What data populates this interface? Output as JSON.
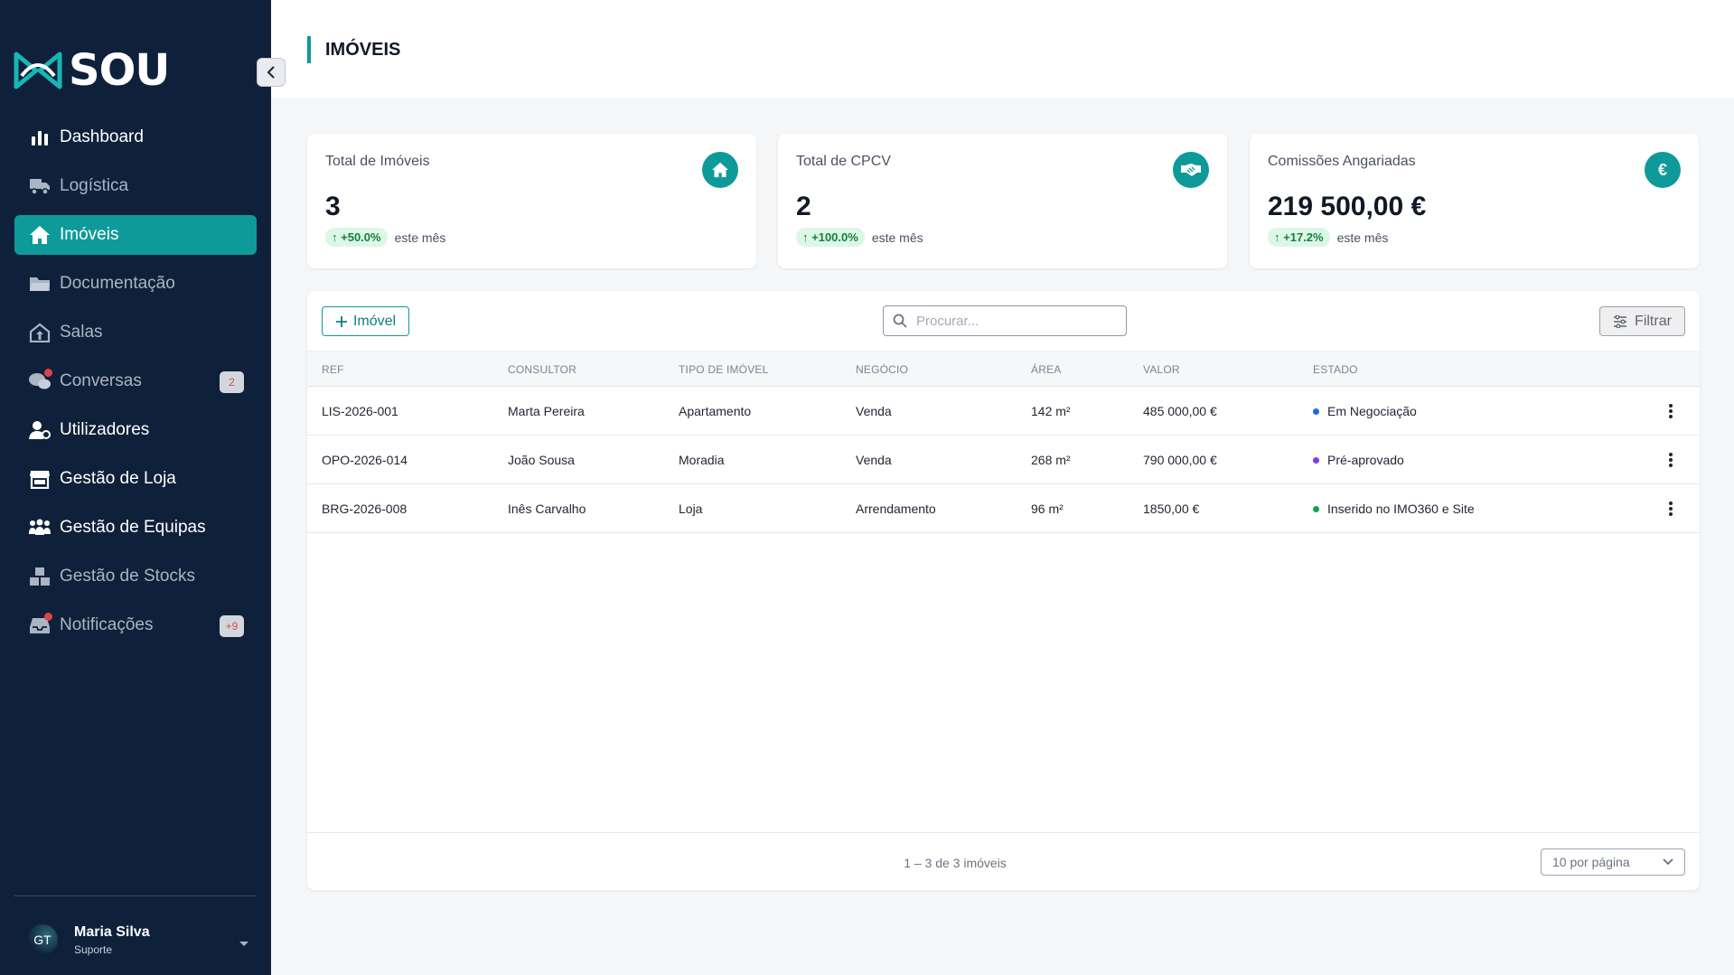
{
  "app": {
    "logo_text": "SOU"
  },
  "sidebar": {
    "items": [
      {
        "label": "Dashboard",
        "icon": "bar-chart-icon"
      },
      {
        "label": "Logística",
        "icon": "truck-icon"
      },
      {
        "label": "Imóveis",
        "icon": "home-icon",
        "active": true
      },
      {
        "label": "Documentação",
        "icon": "folder-icon"
      },
      {
        "label": "Salas",
        "icon": "room-icon"
      },
      {
        "label": "Conversas",
        "icon": "chat-icon",
        "badge": "2"
      },
      {
        "label": "Utilizadores",
        "icon": "user-gear-icon"
      },
      {
        "label": "Gestão de Loja",
        "icon": "store-icon"
      },
      {
        "label": "Gestão de Equipas",
        "icon": "team-icon"
      },
      {
        "label": "Gestão de Stocks",
        "icon": "boxes-icon"
      },
      {
        "label": "Notificações",
        "icon": "inbox-icon",
        "badge": "+9"
      }
    ],
    "user": {
      "initials": "GT",
      "name": "Maria Silva",
      "role": "Suporte"
    }
  },
  "header": {
    "title": "IMÓVEIS"
  },
  "stats": [
    {
      "label": "Total de Imóveis",
      "value": "3",
      "delta": "+50.0%",
      "note": "este mês",
      "icon": "home-icon"
    },
    {
      "label": "Total de CPCV",
      "value": "2",
      "delta": "+100.0%",
      "note": "este mês",
      "icon": "handshake-icon"
    },
    {
      "label": "Comissões Angariadas",
      "value": "219 500,00 €",
      "delta": "+17.2%",
      "note": "este mês",
      "icon": "euro-icon",
      "icon_glyph": "€"
    }
  ],
  "toolbar": {
    "add_label": "Imóvel",
    "search_placeholder": "Procurar...",
    "filter_label": "Filtrar"
  },
  "table": {
    "columns": [
      "REF",
      "CONSULTOR",
      "TIPO DE IMÓVEL",
      "NEGÓCIO",
      "ÁREA",
      "VALOR",
      "ESTADO"
    ],
    "rows": [
      {
        "ref": "LIS-2026-001",
        "consultor": "Marta Pereira",
        "tipo": "Apartamento",
        "negocio": "Venda",
        "area": "142 m²",
        "valor": "485 000,00 €",
        "estado": "Em Negociação",
        "estado_color": "#2563eb"
      },
      {
        "ref": "OPO-2026-014",
        "consultor": "João Sousa",
        "tipo": "Moradia",
        "negocio": "Venda",
        "area": "268 m²",
        "valor": "790 000,00 €",
        "estado": "Pré-aprovado",
        "estado_color": "#7c3aed"
      },
      {
        "ref": "BRG-2026-008",
        "consultor": "Inês Carvalho",
        "tipo": "Loja",
        "negocio": "Arrendamento",
        "area": "96 m²",
        "valor": "1850,00 €",
        "estado": "Inserido no IMO360 e Site",
        "estado_color": "#16a34a"
      }
    ]
  },
  "pagination": {
    "summary": "1 – 3 de 3 imóveis",
    "per_page": "10 por página"
  },
  "colors": {
    "sidebar_bg": "#0f213a",
    "accent": "#0f9a9a",
    "positive": "#15803d"
  }
}
